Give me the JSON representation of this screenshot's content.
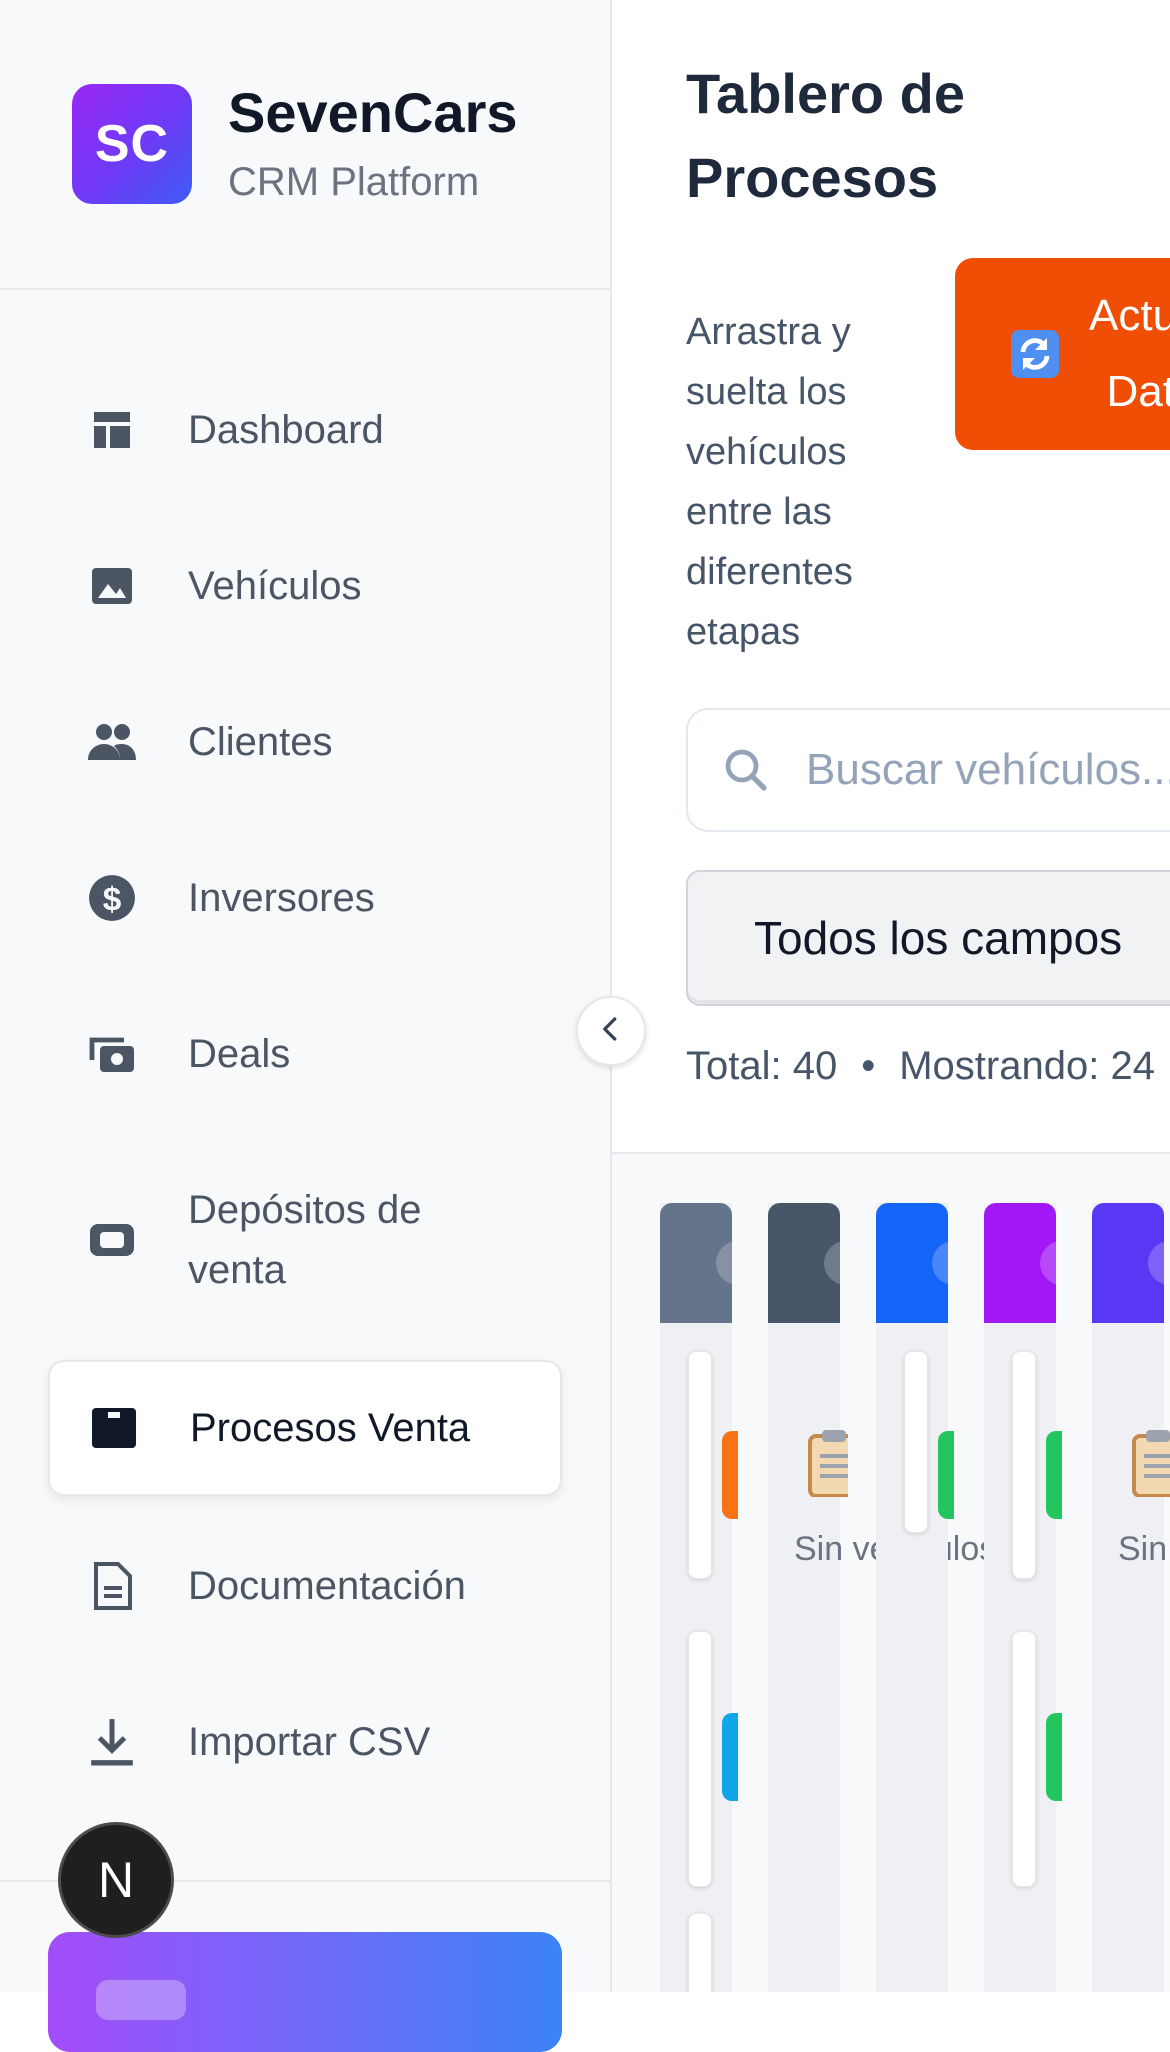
{
  "brand": {
    "logo_text": "SC",
    "name": "SevenCars",
    "subtitle": "CRM Platform",
    "logo_gradient": [
      "#9a27f5",
      "#3d5cf7"
    ]
  },
  "sidebar": {
    "items": [
      {
        "label": "Dashboard",
        "icon": "dashboard-icon"
      },
      {
        "label": "Vehículos",
        "icon": "image-icon"
      },
      {
        "label": "Clientes",
        "icon": "users-icon"
      },
      {
        "label": "Inversores",
        "icon": "dollar-circle-icon"
      },
      {
        "label": "Deals",
        "icon": "money-stack-icon"
      },
      {
        "label": "Depósitos de venta",
        "icon": "wallet-icon"
      },
      {
        "label": "Procesos Venta",
        "icon": "kanban-icon",
        "active": true
      },
      {
        "label": "Documentación",
        "icon": "document-icon"
      },
      {
        "label": "Importar CSV",
        "icon": "download-icon"
      }
    ],
    "collapse_icon": "chevron-left-icon",
    "dev_badge_text": "N"
  },
  "main": {
    "title": "Tablero de Procesos",
    "description": "Arrastra y suelta los vehículos entre las diferentes etapas",
    "refresh_button": {
      "label": "Actualizar Datos",
      "icon": "refresh-icon",
      "color": "#f04d05"
    },
    "search": {
      "placeholder": "Buscar vehículos..."
    },
    "field_filter": {
      "selected": "Todos los campos"
    },
    "stats": {
      "total": "Total: 40",
      "showing": "Mostrando: 24"
    }
  },
  "board": {
    "columns": [
      {
        "color": "#64748b"
      },
      {
        "color": "#475569",
        "empty_text": "Sin vehículos",
        "empty_icon": "clipboard-icon"
      },
      {
        "color": "#1565f9"
      },
      {
        "color": "#a217f6"
      },
      {
        "color": "#5a37f5",
        "empty_text": "Sin vehículos",
        "empty_icon": "clipboard-icon"
      }
    ]
  }
}
